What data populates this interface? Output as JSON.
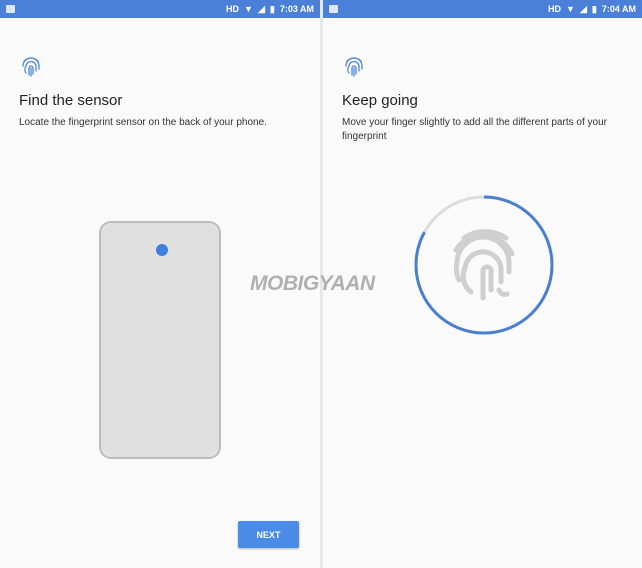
{
  "left": {
    "status": {
      "badge": "HD",
      "time": "7:03 AM"
    },
    "title": "Find the sensor",
    "description": "Locate the fingerprint sensor on the back of your phone.",
    "next_label": "NEXT",
    "sensor_color": "#3f7fe0"
  },
  "right": {
    "status": {
      "badge": "HD",
      "time": "7:04 AM"
    },
    "title": "Keep going",
    "description": "Move your finger slightly to add all the different parts of your fingerprint",
    "progress": 0.83,
    "progress_color": "#4a7fd0"
  },
  "watermark": "MOBIGYAAN"
}
